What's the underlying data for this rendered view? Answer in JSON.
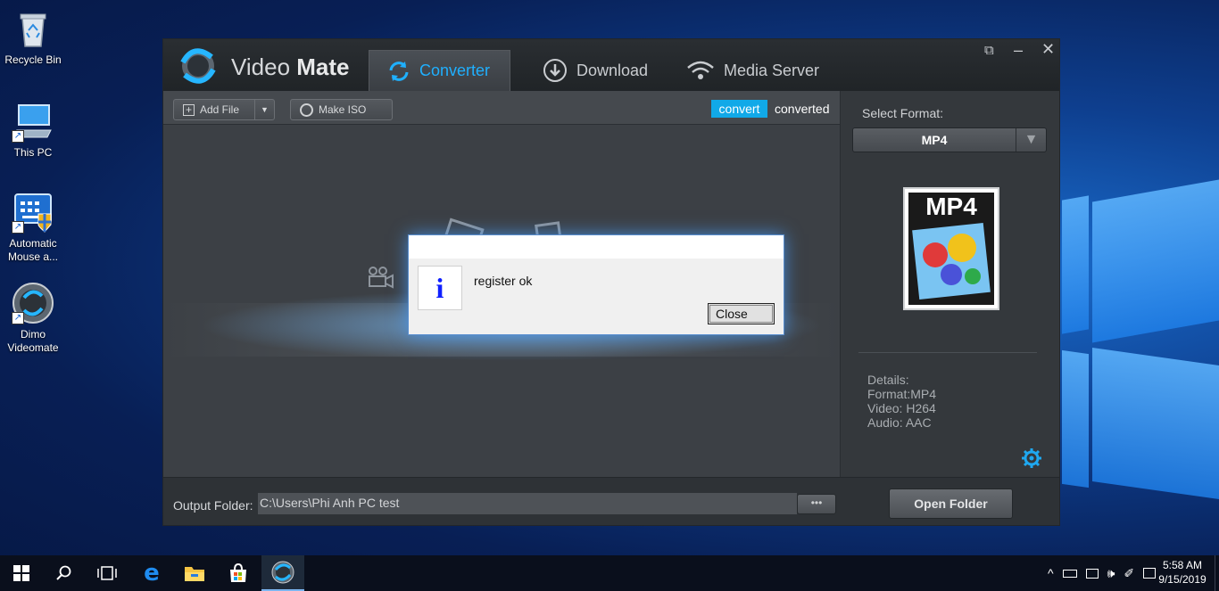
{
  "desktop": {
    "icons": [
      {
        "label": "Recycle Bin"
      },
      {
        "label": "This PC"
      },
      {
        "label": "Automatic Mouse a..."
      },
      {
        "label": "Dimo Videomate"
      }
    ]
  },
  "app": {
    "name_light": "Video",
    "name_bold": "Mate",
    "tabs": [
      {
        "label": "Converter",
        "active": true
      },
      {
        "label": "Download"
      },
      {
        "label": "Media Server"
      }
    ],
    "toolbar": {
      "add_file": "Add File",
      "make_iso": "Make ISO",
      "convert": "convert",
      "converted": "converted"
    },
    "right_panel": {
      "select_format_label": "Select Format:",
      "format_value": "MP4",
      "thumb_label": "MP4",
      "details_title": "Details:",
      "details": [
        "Format:MP4",
        "Video: H264",
        "Audio: AAC"
      ]
    },
    "bottom": {
      "output_label": "Output Folder:",
      "output_path": "C:\\Users\\Phi Anh PC test",
      "browse": "•••",
      "open_folder": "Open Folder"
    }
  },
  "dialog": {
    "message": "register ok",
    "close": "Close"
  },
  "taskbar": {
    "time": "5:58 AM",
    "date": "9/15/2019"
  },
  "colors": {
    "accent": "#1fb0ff",
    "convert_bg": "#11a9e8",
    "dialog_info": "#1020ff"
  }
}
